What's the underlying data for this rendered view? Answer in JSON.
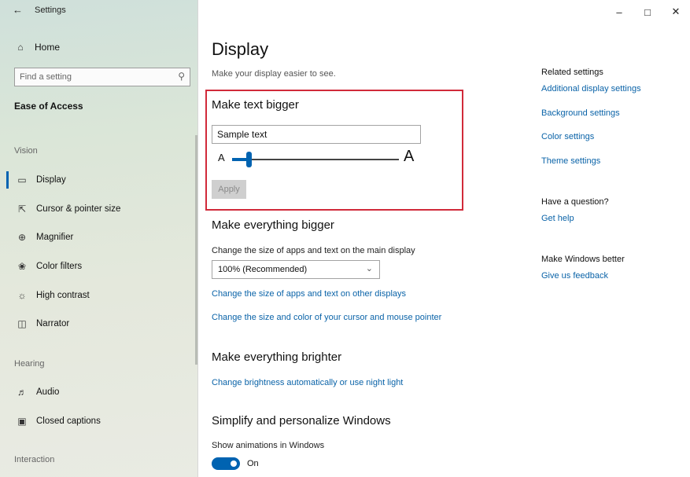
{
  "sidebar": {
    "title": "Settings",
    "home": "Home",
    "search_placeholder": "Find a setting",
    "section": "Ease of Access",
    "groups": {
      "vision": "Vision",
      "hearing": "Hearing",
      "interaction": "Interaction"
    },
    "items": [
      {
        "label": "Display",
        "icon": "monitor-icon",
        "active": true
      },
      {
        "label": "Cursor & pointer size",
        "icon": "cursor-icon"
      },
      {
        "label": "Magnifier",
        "icon": "magnifier-icon"
      },
      {
        "label": "Color filters",
        "icon": "color-filter-icon"
      },
      {
        "label": "High contrast",
        "icon": "contrast-icon"
      },
      {
        "label": "Narrator",
        "icon": "narrator-icon"
      },
      {
        "label": "Audio",
        "icon": "speaker-icon"
      },
      {
        "label": "Closed captions",
        "icon": "cc-icon"
      }
    ]
  },
  "main": {
    "title": "Display",
    "subtitle": "Make your display easier to see.",
    "text_bigger": {
      "heading": "Make text bigger",
      "sample_value": "Sample text",
      "small_a": "A",
      "big_a": "A",
      "slider_fraction": 0.1,
      "apply_label": "Apply"
    },
    "everything_bigger": {
      "heading": "Make everything bigger",
      "label": "Change the size of apps and text on the main display",
      "dropdown_value": "100% (Recommended)",
      "link1": "Change the size of apps and text on other displays",
      "link2": "Change the size and color of your cursor and mouse pointer"
    },
    "brighter": {
      "heading": "Make everything brighter",
      "link": "Change brightness automatically or use night light"
    },
    "simplify": {
      "heading": "Simplify and personalize Windows",
      "label": "Show animations in Windows",
      "toggle_state": "On"
    }
  },
  "rail": {
    "related_heading": "Related settings",
    "related_links": [
      "Additional display settings",
      "Background settings",
      "Color settings",
      "Theme settings"
    ],
    "question_heading": "Have a question?",
    "help_link": "Get help",
    "better_heading": "Make Windows better",
    "feedback_link": "Give us feedback"
  },
  "colors": {
    "accent": "#0063b1",
    "link": "#0a63a8",
    "highlight": "#d12a3a"
  }
}
